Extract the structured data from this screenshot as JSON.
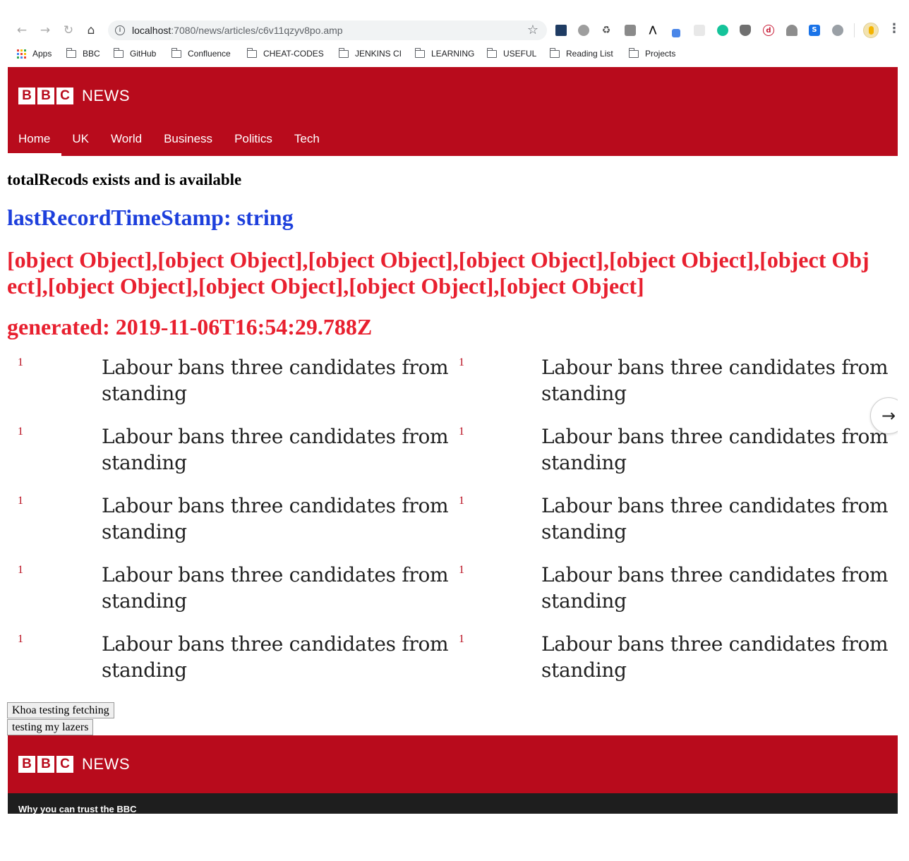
{
  "browser": {
    "url_host": "localhost",
    "url_rest": ":7080/news/articles/c6v11qzyv8po.amp",
    "bookmarks": [
      {
        "label": "Apps",
        "icon": "apps-grid-icon"
      },
      {
        "label": "BBC",
        "icon": "folder-icon"
      },
      {
        "label": "GitHub",
        "icon": "folder-icon"
      },
      {
        "label": "Confluence",
        "icon": "folder-icon"
      },
      {
        "label": "CHEAT-CODES",
        "icon": "folder-icon"
      },
      {
        "label": "JENKINS CI",
        "icon": "folder-icon"
      },
      {
        "label": "LEARNING",
        "icon": "folder-icon"
      },
      {
        "label": "USEFUL",
        "icon": "folder-icon"
      },
      {
        "label": "Reading List",
        "icon": "folder-icon"
      },
      {
        "label": "Projects",
        "icon": "folder-icon"
      }
    ],
    "extension_letters": {
      "s": "S",
      "d": "d"
    }
  },
  "header": {
    "logo_letters": [
      "B",
      "B",
      "C"
    ],
    "logo_news": "NEWS",
    "nav": [
      {
        "label": "Home",
        "active": true
      },
      {
        "label": "UK"
      },
      {
        "label": "World"
      },
      {
        "label": "Business"
      },
      {
        "label": "Politics"
      },
      {
        "label": "Tech"
      }
    ]
  },
  "content": {
    "total_records": "totalRecods exists and is available",
    "last_record": "lastRecordTimeStamp: string",
    "objects": "[object Object],[object Object],[object Object],[object Object],[object Object],[object Object],[object Object],[object Object],[object Object],[object Object]",
    "generated": "generated: 2019-11-06T16:54:29.788Z"
  },
  "stories": [
    {
      "rank": "1",
      "headline": "Labour bans three candidates from standing"
    },
    {
      "rank": "1",
      "headline": "Labour bans three candidates from standing"
    },
    {
      "rank": "1",
      "headline": "Labour bans three candidates from standing"
    },
    {
      "rank": "1",
      "headline": "Labour bans three candidates from standing"
    },
    {
      "rank": "1",
      "headline": "Labour bans three candidates from standing"
    },
    {
      "rank": "1",
      "headline": "Labour bans three candidates from standing"
    },
    {
      "rank": "1",
      "headline": "Labour bans three candidates from standing"
    },
    {
      "rank": "1",
      "headline": "Labour bans three candidates from standing"
    },
    {
      "rank": "1",
      "headline": "Labour bans three candidates from standing"
    },
    {
      "rank": "1",
      "headline": "Labour bans three candidates from standing"
    }
  ],
  "buttons": {
    "khoa": "Khoa testing fetching",
    "lazers": "testing my lazers"
  },
  "footer": {
    "logo_letters": [
      "B",
      "B",
      "C"
    ],
    "logo_news": "NEWS",
    "trust_link": "Why you can trust the BBC"
  },
  "colors": {
    "bbc_red": "#b80b1c",
    "blue_heading": "#1d3fdc",
    "red_heading": "#e8202f",
    "footer_dark": "#1e1e1e"
  }
}
